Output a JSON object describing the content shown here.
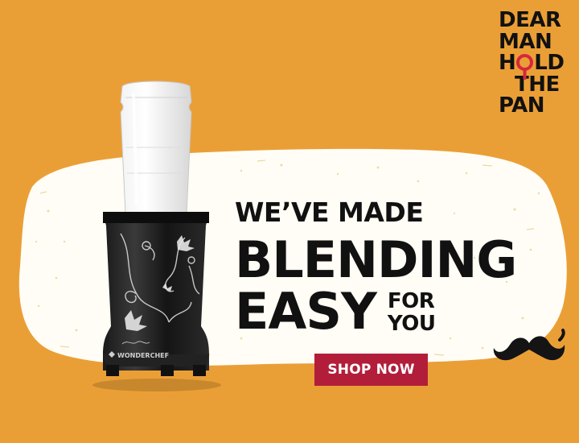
{
  "brand": {
    "lines": [
      "DEAR",
      "MAN",
      "H",
      "LD",
      "THE",
      "PAN"
    ]
  },
  "headline": {
    "line1": "WE’VE MADE",
    "line2": "BLENDING",
    "line3": "EASY",
    "line3_side_a": "FOR",
    "line3_side_b": "YOU"
  },
  "cta": {
    "label": "SHOP NOW"
  },
  "product": {
    "logo_text": "WONDERCHEF"
  },
  "colors": {
    "background": "#ea9f36",
    "blob": "#fffdf5",
    "cta": "#b21e3a",
    "brand_accent": "#d6273d",
    "text": "#111111"
  },
  "icons": [
    "magnifier-icon",
    "mustache-icon",
    "wonderchef-logo-icon"
  ]
}
